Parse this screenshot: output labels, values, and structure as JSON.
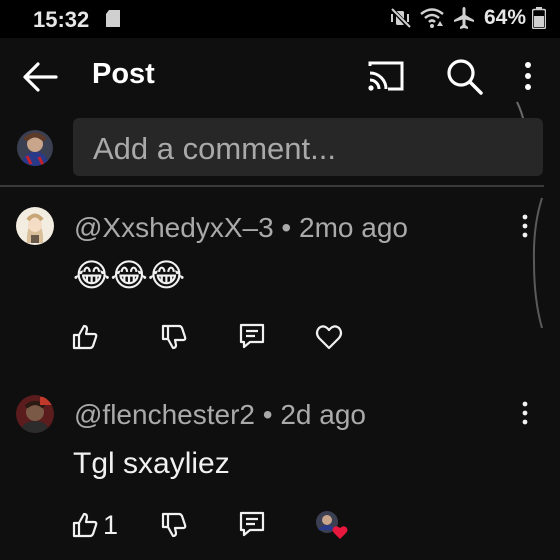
{
  "status_bar": {
    "time": "15:32",
    "battery": "64%"
  },
  "header": {
    "title": "Post"
  },
  "comment_input": {
    "placeholder": "Add a comment..."
  },
  "comments": [
    {
      "author": "@XxshedyxX–3",
      "separator": "•",
      "age": "2mo ago",
      "text": "😂😂😂",
      "likes": ""
    },
    {
      "author": "@flenchester2",
      "separator": "•",
      "age": "2d ago",
      "text": "Tgl sxayliez",
      "likes": "1"
    }
  ],
  "colors": {
    "background": "#0f0f0f",
    "input": "#272727",
    "heart": "#e8173c"
  }
}
